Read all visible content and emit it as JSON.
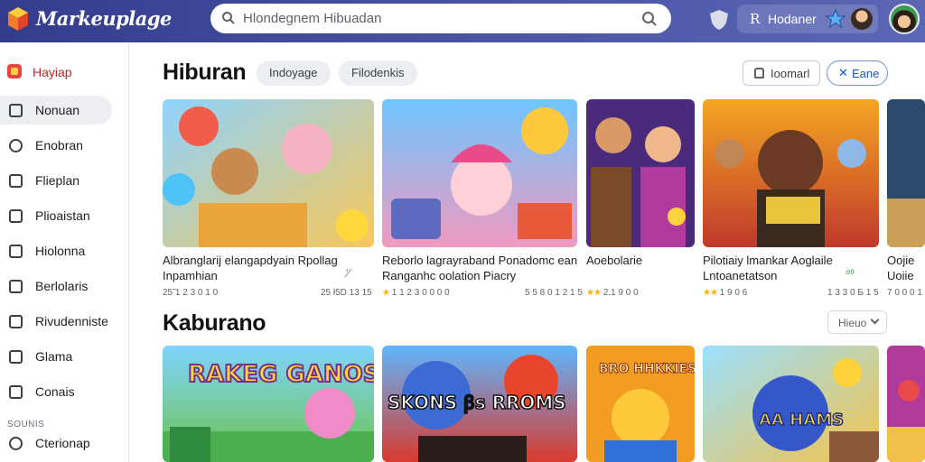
{
  "header": {
    "brand": "Markeuplage",
    "search_value": "Hlondegnem Hibuadan",
    "user_r": "R",
    "user_name": "Hodaner"
  },
  "sidebar": {
    "header_label": "Hayiap",
    "items": [
      {
        "label": "Nonuan",
        "active": true
      },
      {
        "label": "Enobran"
      },
      {
        "label": "Flieplan"
      },
      {
        "label": "Plioaistan"
      },
      {
        "label": "Hiolonna"
      },
      {
        "label": "Berlolaris"
      },
      {
        "label": "Rivudenniste"
      },
      {
        "label": "Glama"
      },
      {
        "label": "Conais"
      }
    ],
    "section_label": "SOUNIS",
    "bottom_item": "Cterionap"
  },
  "section1": {
    "title": "Hiburan",
    "chips": [
      "Indoyage",
      "Filodenkis"
    ],
    "button_outline": "Ioomarl",
    "button_blue": "Eane",
    "button_blue_icon": "✕",
    "cards": [
      {
        "title_line1": "Albranglarij elangapdyain Rpollag",
        "title_line2": "Inpamhian",
        "side": "ʼ⁄",
        "meta_left": "25̃ 1 2 3 0 1 0",
        "meta_right": "25 ł5D 13 15",
        "stars": ""
      },
      {
        "title_line1": "Reborlo lagrayraband Ponadomc ean",
        "title_line2": "Ranganhc oolation Piacry",
        "side": "",
        "meta_left": "1 1 2 3 0 0 0 0",
        "meta_right": "5 5 8 0 1 2 1 5",
        "stars": "★"
      },
      {
        "title_line1": "Aoebolarie",
        "title_line2": "",
        "side": "",
        "meta_left": "2.1 9 0 0",
        "meta_right": "",
        "stars": "★★"
      },
      {
        "title_line1": "Pilotiaiy lmankar Aoglaile",
        "title_line2": "Lntoanetatson",
        "side": "ᵒ⁹",
        "meta_left": "1 9 0 6",
        "meta_right": "1 3 3 0 Б 1 5",
        "stars": "★★"
      },
      {
        "title_line1": "Oojie",
        "title_line2": "Uoiie",
        "side": "",
        "meta_left": "7 0 0 0 1",
        "meta_right": "",
        "stars": ""
      }
    ]
  },
  "section2": {
    "title": "Kaburano",
    "select_value": "Hieuo",
    "cards": [
      {
        "art_text": "RAKEG GANOS"
      },
      {
        "art_text": "SKONS ꞵs RROMS"
      },
      {
        "art_text": "BRO HHKKIES"
      },
      {
        "art_text": "AA HAMS"
      },
      {
        "art_text": ""
      }
    ]
  },
  "icons": [
    "cube-logo-icon",
    "search-icon",
    "shield-icon",
    "star-icon",
    "monitor-icon",
    "gear-icon"
  ],
  "colors": {
    "header": "#3b4596",
    "accent_red": "#c1272d",
    "link_blue": "#1a55c8",
    "star": "#f4b400"
  }
}
